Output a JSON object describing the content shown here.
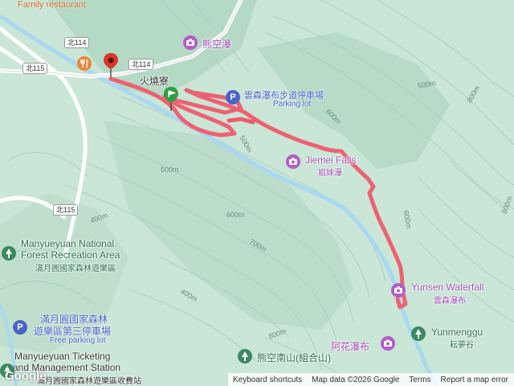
{
  "map": {
    "route_color": "#f05a6a",
    "terrain_color": "#c9e6d6",
    "river_color": "#a9d8f2",
    "road_color": "#ffffff"
  },
  "labels": {
    "family_restaurant": "Family restaurant",
    "huoshao": "火燒寮",
    "xiongkong_waterfall": "熊空瀑",
    "parking_cn": "雲森瀑布步道停車場",
    "parking_en": "Parking lot",
    "jiemei_en": "Jiemei Falls",
    "jiemei_cn": "姐妹瀑",
    "yunsen_en": "Yunsen Waterfall",
    "yunsen_cn": "雲森瀑布",
    "yunmenggu_en": "Yunmenggu",
    "yunmenggu_cn": "耘夢谷",
    "ahua": "阿花瀑布",
    "xiongkong_south": "熊空南山(組合山)",
    "manyueyuan_en_1": "Manyueyuan National",
    "manyueyuan_en_2": "Forest Recreation Area",
    "manyueyuan_cn": "滿月圓國家森林遊樂區",
    "third_parking_1": "滿月圓國家森林",
    "third_parking_2": "遊樂區第三停車場",
    "free_parking": "Free parking lot",
    "ticketing_1": "Manyueyuan Ticketing",
    "ticketing_2": "and Management Station",
    "ticketing_cn": "滿月圓國家森林遊樂區收費站"
  },
  "roads": {
    "r114a": "北114",
    "r114b": "北114",
    "r115a": "北115",
    "r115b": "北115"
  },
  "contours": {
    "c500a": "500m",
    "c500b": "500m",
    "c500c": "500m",
    "c400a": "400m",
    "c400b": "400m",
    "c600a": "600m",
    "c600b": "600m",
    "c600c": "600m",
    "c700": "700m",
    "c800a": "800m",
    "c800b": "800m",
    "c800c": "800m"
  },
  "footer": {
    "brand": "Google",
    "keyboard": "Keyboard shortcuts",
    "mapdata": "Map data ©2026 Google",
    "terms": "Terms",
    "report": "Report a map error"
  },
  "icons": {
    "waterfall": "waterfall-camera-icon",
    "parking": "parking-icon",
    "park": "park-tree-icon",
    "restaurant": "restaurant-fork-icon",
    "start": "green-flag-icon",
    "end": "red-pin-icon"
  }
}
